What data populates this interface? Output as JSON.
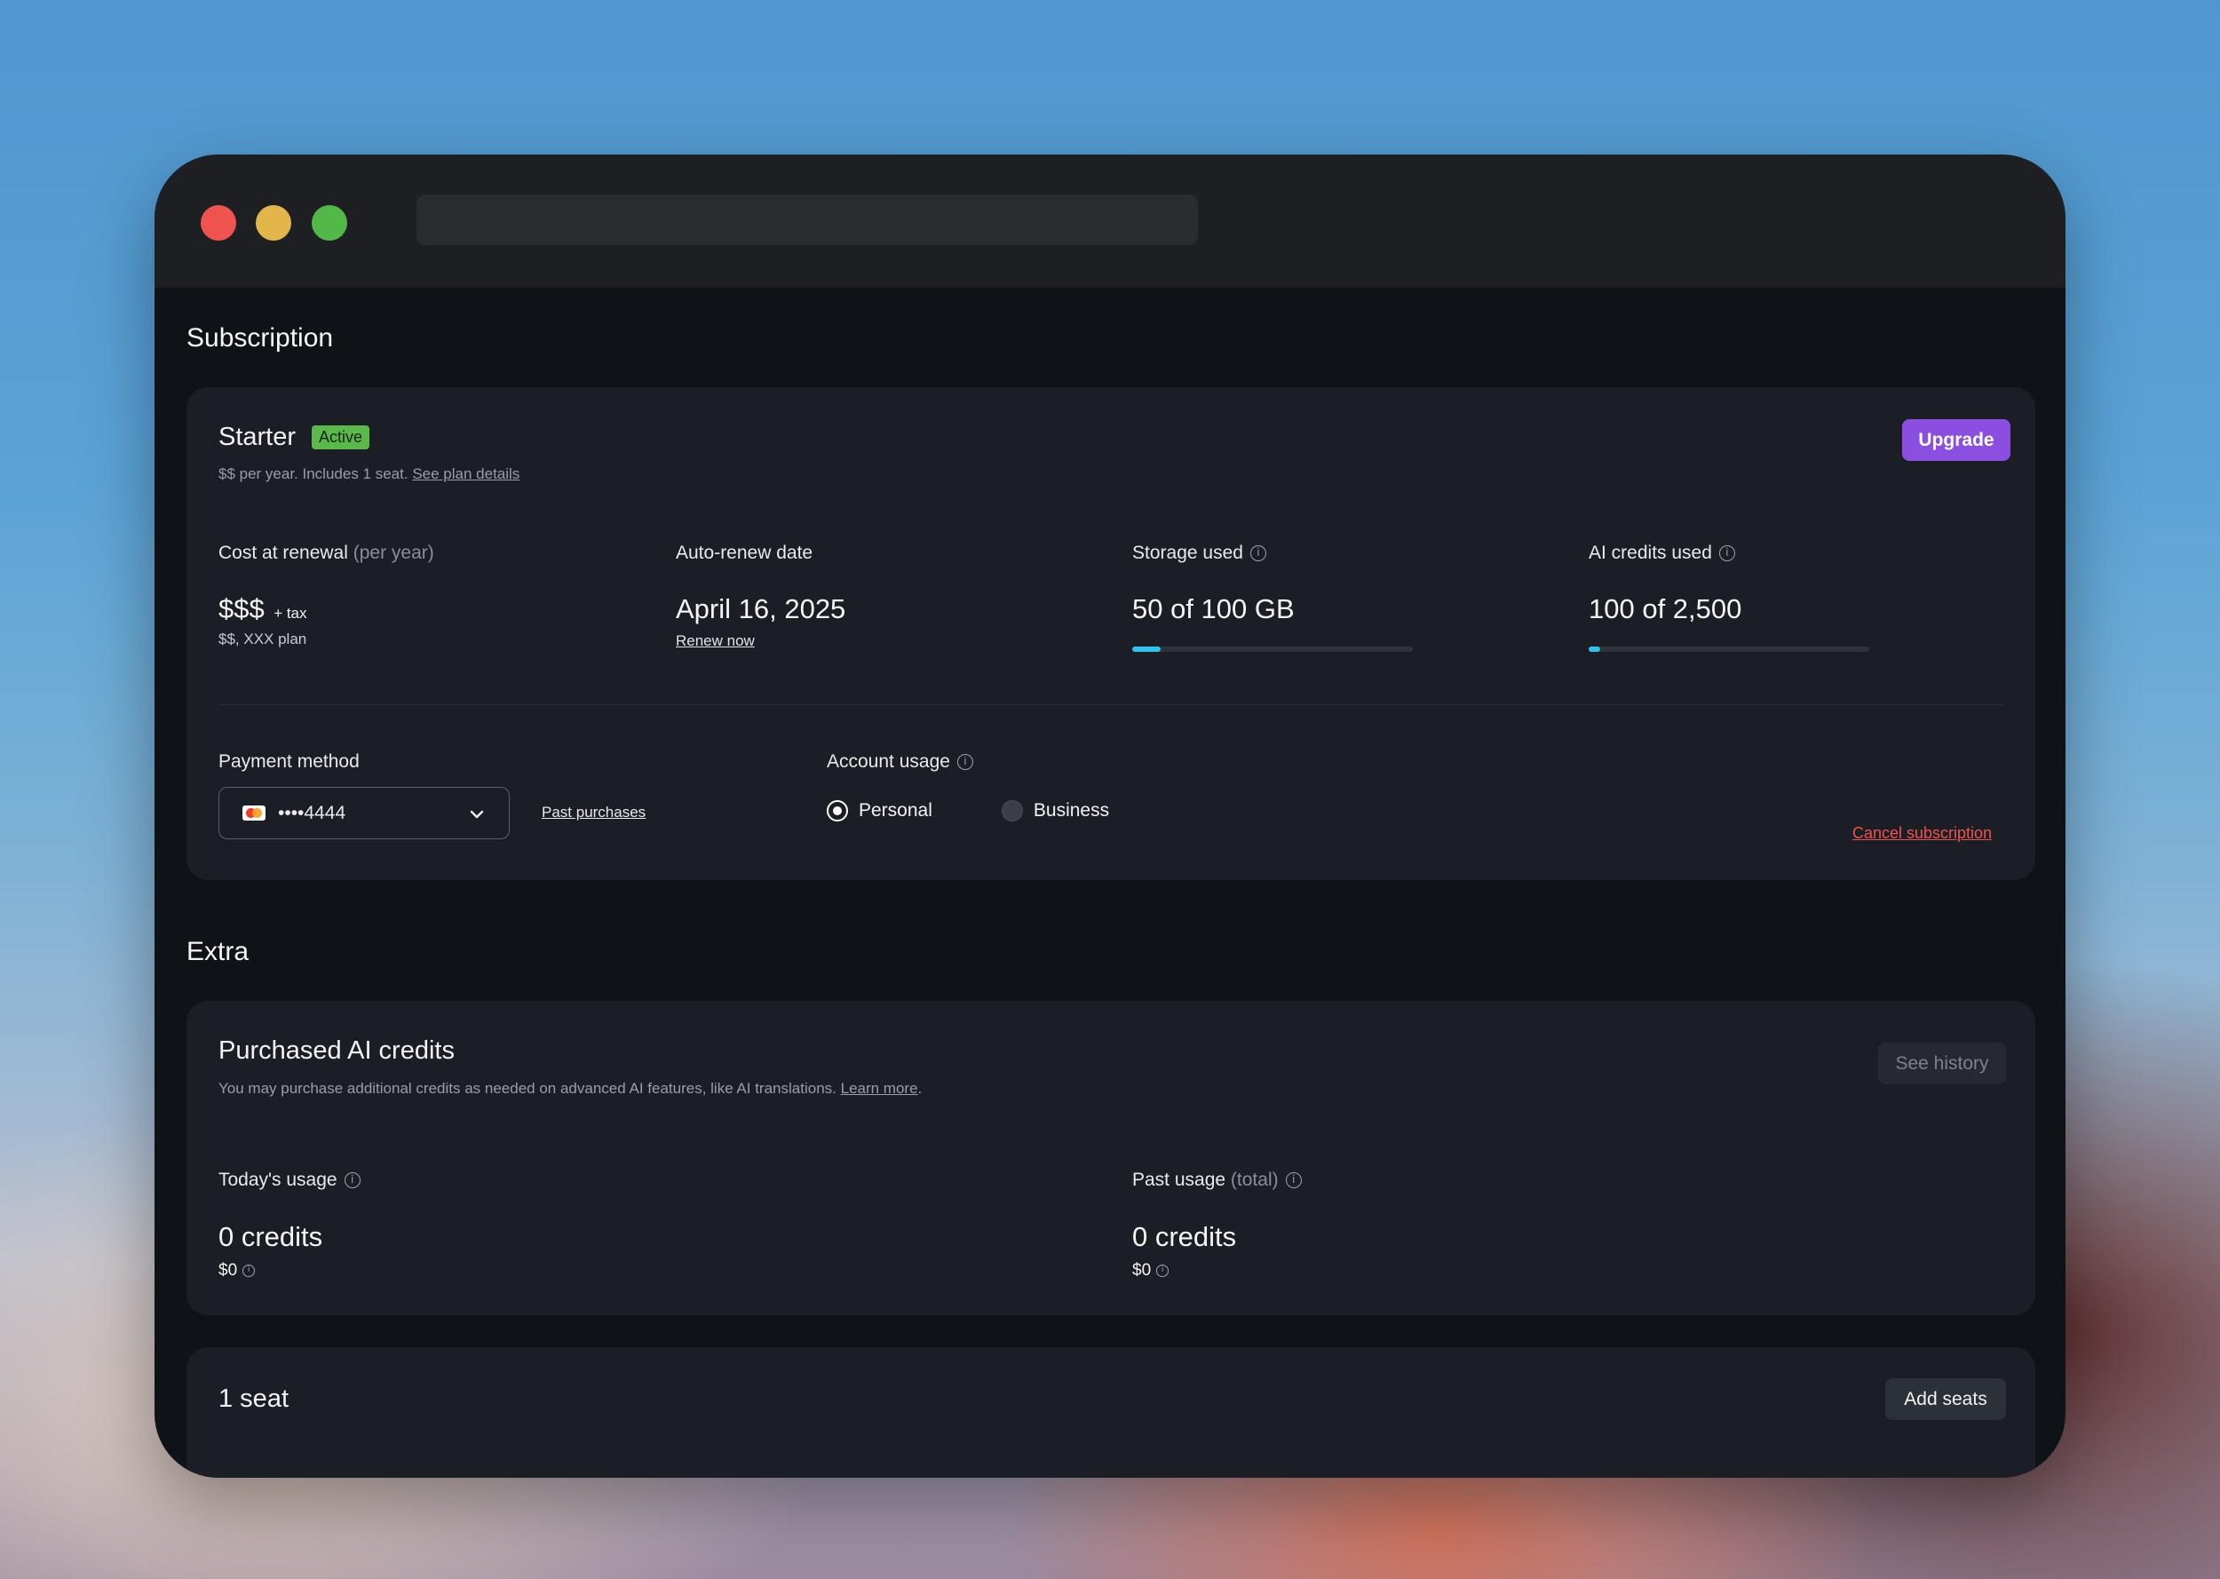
{
  "subscription": {
    "section_title": "Subscription",
    "plan_name": "Starter",
    "status_badge": "Active",
    "plan_desc": "$$ per year. Includes 1 seat.",
    "plan_details_link": "See plan details",
    "upgrade_label": "Upgrade",
    "cost": {
      "label": "Cost at renewal",
      "qualifier": "(per year)",
      "value": "$$$",
      "tax": "+ tax",
      "plan": "$$, XXX plan"
    },
    "renew": {
      "label": "Auto-renew date",
      "value": "April 16, 2025",
      "link": "Renew now"
    },
    "storage": {
      "label": "Storage used",
      "value": "50 of 100 GB",
      "progress": 0.1
    },
    "ai_credits": {
      "label": "AI credits used",
      "value": "100 of 2,500",
      "progress": 0.04
    },
    "payment": {
      "label": "Payment method",
      "card": "••••4444",
      "past_purchases": "Past purchases"
    },
    "account_usage": {
      "label": "Account usage",
      "options": [
        "Personal",
        "Business"
      ],
      "selected": "Personal"
    },
    "cancel_label": "Cancel subscription"
  },
  "extra": {
    "section_title": "Extra",
    "credits_card": {
      "title": "Purchased AI credits",
      "desc": "You may purchase additional credits as needed on advanced AI features, like AI translations.",
      "learn_more": "Learn more",
      "see_history": "See history",
      "today": {
        "label": "Today's usage",
        "value": "0 credits",
        "cost": "$0"
      },
      "past": {
        "label": "Past usage",
        "qualifier": "(total)",
        "value": "0 credits",
        "cost": "$0"
      }
    },
    "seats_card": {
      "title": "1 seat",
      "add_label": "Add seats"
    }
  },
  "colors": {
    "accent": "#8a4fe0",
    "active_badge": "#5bb84a",
    "progress": "#2ec4ee",
    "danger": "#ef5350"
  }
}
